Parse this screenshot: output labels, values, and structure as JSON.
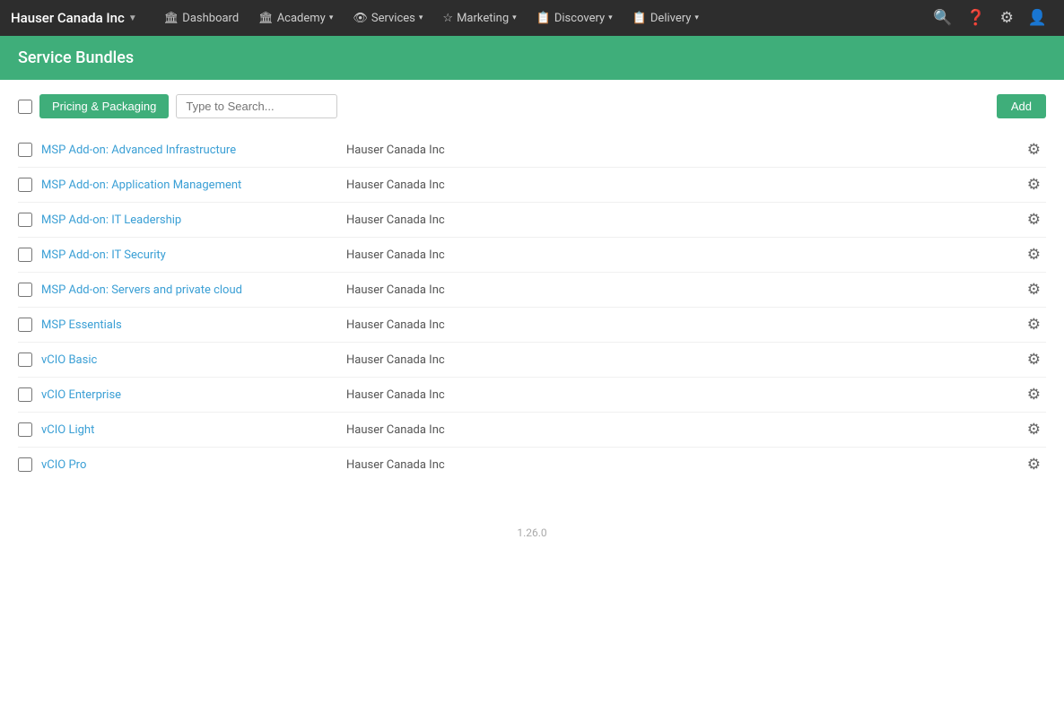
{
  "brand": {
    "name": "Hauser Canada Inc",
    "caret": "▼"
  },
  "nav": {
    "items": [
      {
        "id": "dashboard",
        "label": "Dashboard",
        "icon": "🏛",
        "hasDropdown": false
      },
      {
        "id": "academy",
        "label": "Academy",
        "icon": "🏛",
        "hasDropdown": true
      },
      {
        "id": "services",
        "label": "Services",
        "icon": "👁",
        "hasDropdown": true
      },
      {
        "id": "marketing",
        "label": "Marketing",
        "icon": "☆",
        "hasDropdown": true
      },
      {
        "id": "discovery",
        "label": "Discovery",
        "icon": "📋",
        "hasDropdown": true
      },
      {
        "id": "delivery",
        "label": "Delivery",
        "icon": "📋",
        "hasDropdown": true
      }
    ]
  },
  "page_title": "Service Bundles",
  "toolbar": {
    "tab_label": "Pricing & Packaging",
    "search_placeholder": "Type to Search...",
    "add_label": "Add"
  },
  "bundles": [
    {
      "name": "MSP Add-on: Advanced Infrastructure",
      "company": "Hauser Canada Inc"
    },
    {
      "name": "MSP Add-on: Application Management",
      "company": "Hauser Canada Inc"
    },
    {
      "name": "MSP Add-on: IT Leadership",
      "company": "Hauser Canada Inc"
    },
    {
      "name": "MSP Add-on: IT Security",
      "company": "Hauser Canada Inc"
    },
    {
      "name": "MSP Add-on: Servers and private cloud",
      "company": "Hauser Canada Inc"
    },
    {
      "name": "MSP Essentials",
      "company": "Hauser Canada Inc"
    },
    {
      "name": "vCIO Basic",
      "company": "Hauser Canada Inc"
    },
    {
      "name": "vCIO Enterprise",
      "company": "Hauser Canada Inc"
    },
    {
      "name": "vCIO Light",
      "company": "Hauser Canada Inc"
    },
    {
      "name": "vCIO Pro",
      "company": "Hauser Canada Inc"
    }
  ],
  "footer": {
    "version": "1.26.0"
  }
}
